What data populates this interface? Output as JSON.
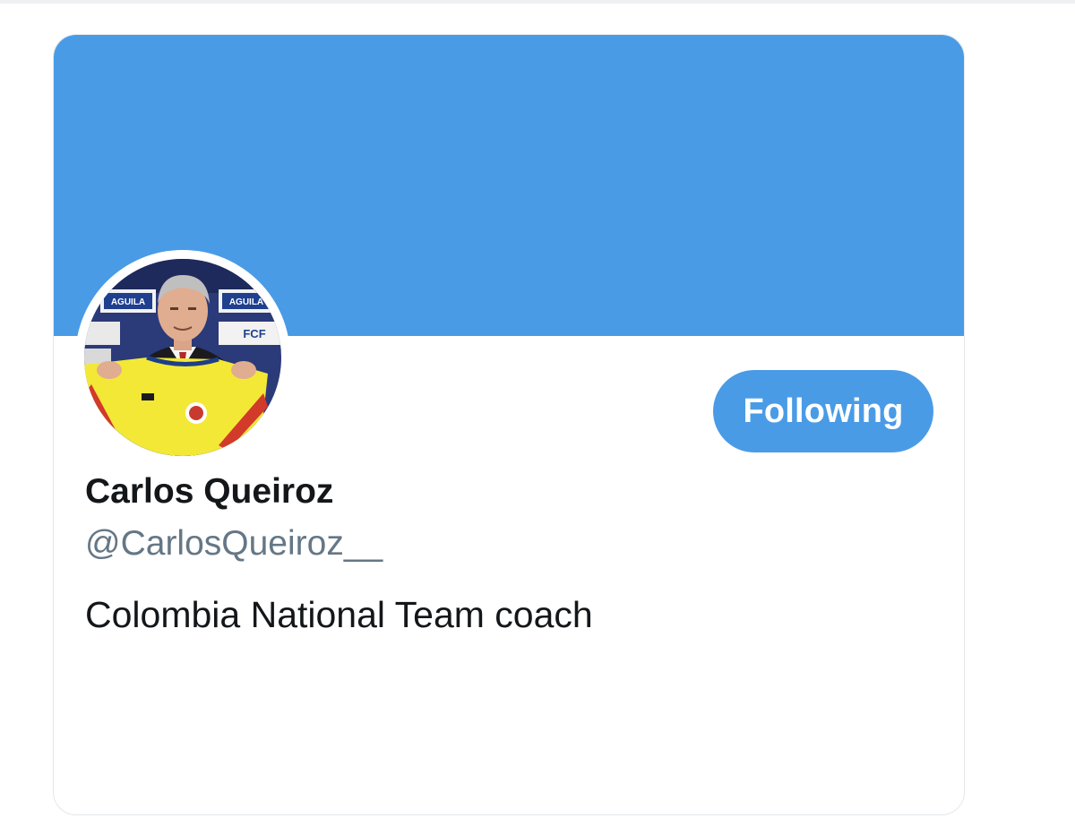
{
  "profile": {
    "display_name": "Carlos Queiroz",
    "handle": "@CarlosQueiroz__",
    "bio": "Colombia National Team coach",
    "follow_button_label": "Following",
    "avatar_board_texts": [
      "AGUILA",
      "AGUILA",
      "FCF"
    ]
  },
  "colors": {
    "banner": "#4a9be6",
    "button": "#4a9be6",
    "name_text": "#14171a",
    "handle_text": "#657786",
    "card_border": "#e3e7ea",
    "jersey_yellow": "#f3e836",
    "jersey_red": "#d23a2a",
    "jersey_blue": "#2a3f8f"
  }
}
